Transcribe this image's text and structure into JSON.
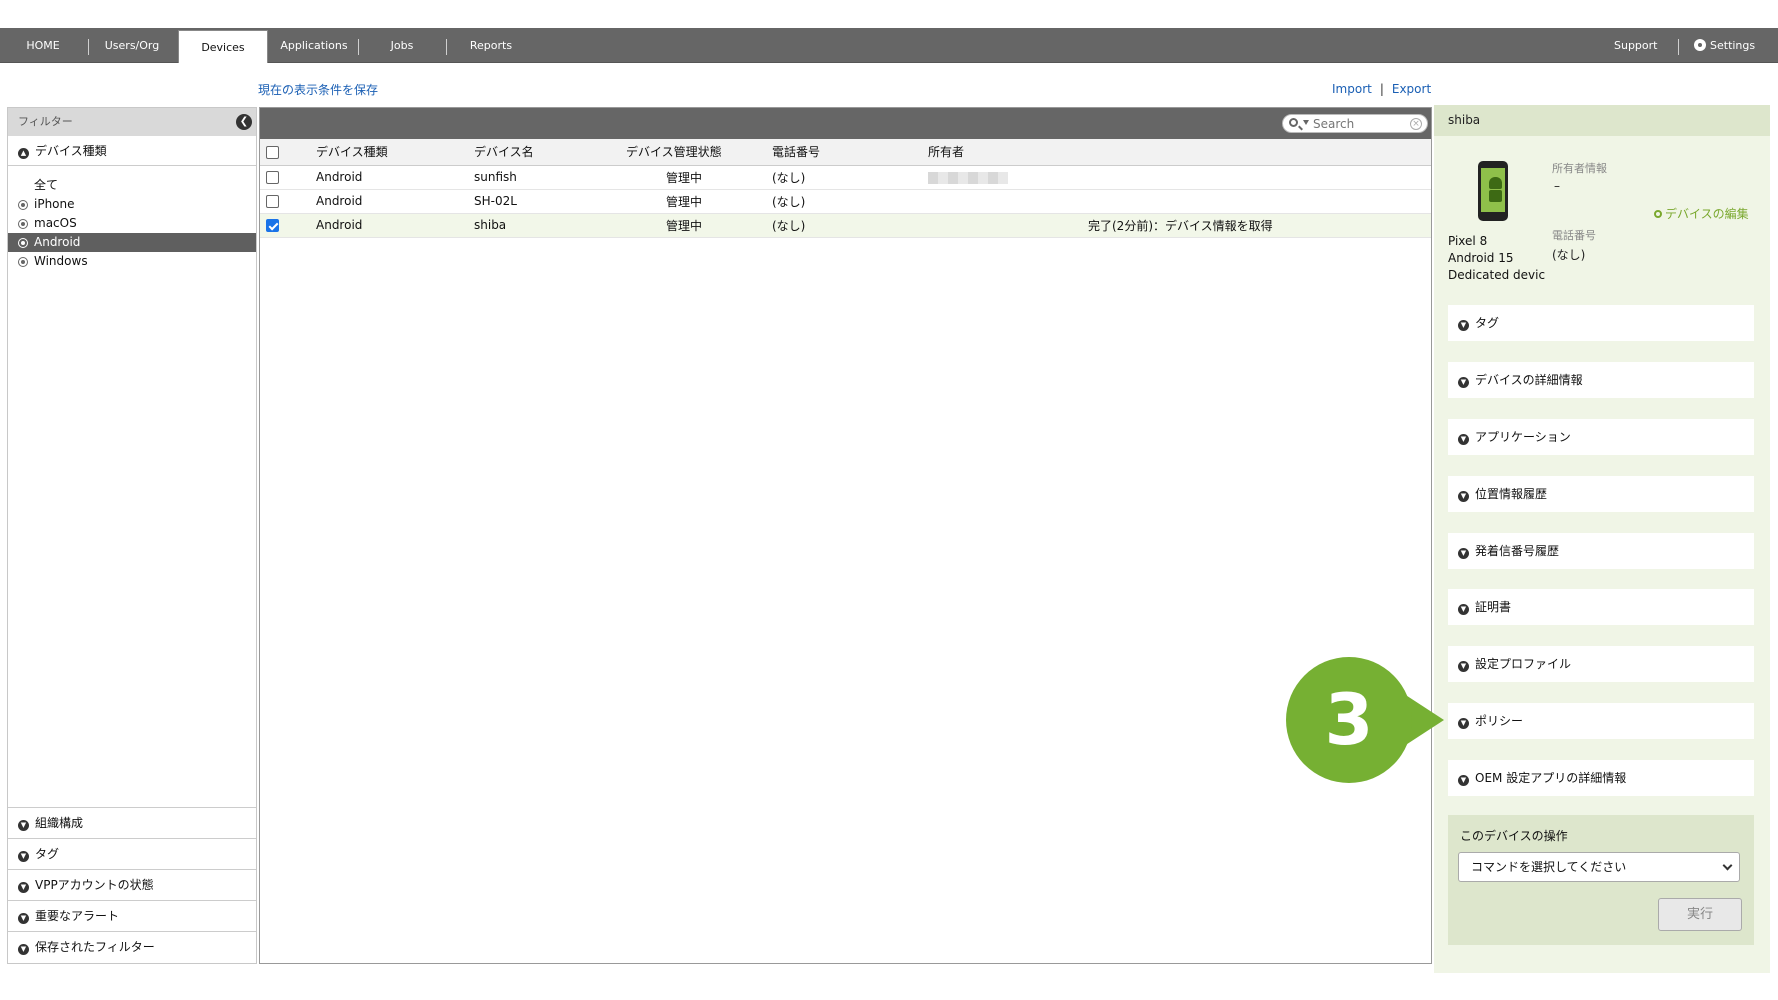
{
  "nav": {
    "tabs": [
      "HOME",
      "Users/Org",
      "Devices",
      "Applications",
      "Jobs",
      "Reports"
    ],
    "active": "Devices",
    "support": "Support",
    "settings": "Settings"
  },
  "toolbar": {
    "save_view": "現在の表示条件を保存",
    "import": "Import",
    "separator": "|",
    "export": "Export"
  },
  "filter": {
    "title": "フィルター",
    "device_type_header": "デバイス種類",
    "items": [
      "全て",
      "iPhone",
      "macOS",
      "Android",
      "Windows"
    ],
    "selected": "Android",
    "bottom_sections": [
      "組織構成",
      "タグ",
      "VPPアカウントの状態",
      "重要なアラート",
      "保存されたフィルター"
    ]
  },
  "table": {
    "search_placeholder": "Search",
    "columns": [
      "デバイス種類",
      "デバイス名",
      "デバイス管理状態",
      "電話番号",
      "所有者"
    ],
    "rows": [
      {
        "type": "Android",
        "name": "sunfish",
        "status": "管理中",
        "phone": "(なし)",
        "owner": "",
        "note": "",
        "checked": false
      },
      {
        "type": "Android",
        "name": "SH-02L",
        "status": "管理中",
        "phone": "(なし)",
        "owner": "",
        "note": "",
        "checked": false
      },
      {
        "type": "Android",
        "name": "shiba",
        "status": "管理中",
        "phone": "(なし)",
        "owner": "",
        "note": "完了(2分前)：デバイス情報を取得",
        "checked": true
      }
    ]
  },
  "detail": {
    "device_name": "shiba",
    "model": "Pixel 8",
    "os": "Android 15",
    "mode": "Dedicated devic",
    "owner_label": "所有者情報",
    "owner_value": "–",
    "phone_label": "電話番号",
    "phone_value": "(なし)",
    "edit_link": "デバイスの編集",
    "sections": [
      "タグ",
      "デバイスの詳細情報",
      "アプリケーション",
      "位置情報履歴",
      "発着信番号履歴",
      "証明書",
      "設定プロファイル",
      "ポリシー",
      "OEM 設定アプリの詳細情報"
    ],
    "ops_title": "このデバイスの操作",
    "ops_select": "コマンドを選択してください",
    "ops_run": "実行"
  },
  "callout": {
    "number": "3",
    "color": "#76b033"
  }
}
